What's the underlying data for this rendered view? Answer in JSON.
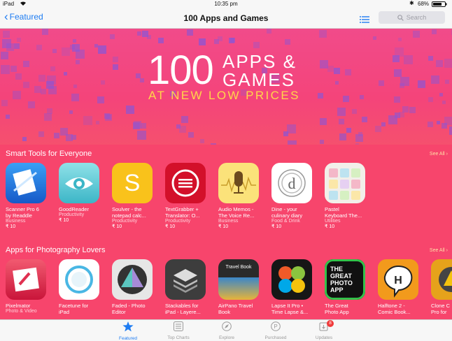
{
  "status": {
    "device": "iPad",
    "time": "10:35 pm",
    "battery": "68%"
  },
  "nav": {
    "back_label": "Featured",
    "title": "100 Apps and Games",
    "search_placeholder": "Search"
  },
  "banner": {
    "number": "100",
    "line1": "APPS &",
    "line2": "GAMES",
    "tagline": "AT NEW LOW PRICES"
  },
  "sections": [
    {
      "title": "Smart Tools for Everyone",
      "see_all": "See All ›",
      "apps": [
        {
          "name1": "Scanner Pro 6",
          "name2": "by Readdle",
          "category": "Business",
          "price": "₹ 10",
          "icon": "scanner-icon"
        },
        {
          "name1": "GoodReader",
          "name2": "Productivity",
          "category": "",
          "price": "₹ 10",
          "icon": "eye-icon"
        },
        {
          "name1": "Soulver - the",
          "name2": "notepad calc...",
          "category": "Productivity",
          "price": "₹ 10",
          "icon": "soulver-icon"
        },
        {
          "name1": "TextGrabber +",
          "name2": "Translator: O...",
          "category": "Productivity",
          "price": "₹ 10",
          "icon": "textgrabber-icon"
        },
        {
          "name1": "Audio Memos -",
          "name2": "The Voice Re...",
          "category": "Business",
          "price": "₹ 10",
          "icon": "microphone-icon"
        },
        {
          "name1": "Dine - your",
          "name2": "culinary diary",
          "category": "Food & Drink",
          "price": "₹ 10",
          "icon": "dine-icon"
        },
        {
          "name1": "Pastel",
          "name2": "Keyboard The...",
          "category": "Utilities",
          "price": "₹ 10",
          "icon": "keyboard-icon"
        }
      ]
    },
    {
      "title": "Apps for Photography Lovers",
      "see_all": "See All ›",
      "apps": [
        {
          "name1": "Pixelmator",
          "name2": "Photo & Video",
          "icon": "pixelmator-icon"
        },
        {
          "name1": "Facetune for",
          "name2": "iPad",
          "icon": "facetune-icon"
        },
        {
          "name1": "Faded - Photo",
          "name2": "Editor",
          "icon": "faded-icon"
        },
        {
          "name1": "Stackables for",
          "name2": "iPad - Layere...",
          "icon": "stack-icon"
        },
        {
          "name1": "AirPano Travel",
          "name2": "Book",
          "icon": "travel-book-icon",
          "icon_text": "Travel Book"
        },
        {
          "name1": "Lapse It Pro •",
          "name2": "Time Lapse &...",
          "icon": "lapse-icon"
        },
        {
          "name1": "The Great",
          "name2": "Photo App",
          "icon": "great-photo-app-icon",
          "icon_text": "THE GREAT PHOTO APP"
        },
        {
          "name1": "Halftone 2 -",
          "name2": "Comic Book...",
          "icon": "halftone-icon"
        },
        {
          "name1": "Clone C",
          "name2": "Pro for",
          "icon": "clone-icon"
        }
      ]
    }
  ],
  "tabs": [
    {
      "label": "Featured",
      "icon": "star-icon"
    },
    {
      "label": "Top Charts",
      "icon": "list-icon"
    },
    {
      "label": "Explore",
      "icon": "compass-icon"
    },
    {
      "label": "Purchased",
      "icon": "purchased-icon"
    },
    {
      "label": "Updates",
      "icon": "updates-icon",
      "badge": "8"
    }
  ],
  "colors": {
    "accent": "#1e7cf2",
    "section_bg": "#f7456c",
    "banner_yellow": "#ffd64a"
  }
}
